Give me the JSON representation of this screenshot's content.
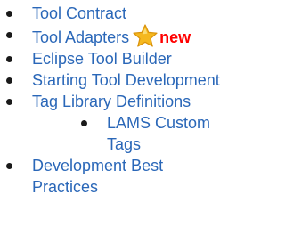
{
  "nav": {
    "items": [
      {
        "label": "Tool Contract"
      },
      {
        "label": "Tool Adapters",
        "badge_icon": "star-icon",
        "badge_text": "new"
      },
      {
        "label": "Eclipse Tool Builder"
      },
      {
        "label": "Starting Tool Development"
      },
      {
        "label": "Tag Library Definitions"
      },
      {
        "label": "LAMS Custom Tags"
      },
      {
        "label": "Development Best Practices"
      }
    ]
  },
  "colors": {
    "link": "#2a67b8",
    "badge": "#ff0000",
    "star_fill": "#f5b81f",
    "bullet": "#1a1a1a"
  }
}
